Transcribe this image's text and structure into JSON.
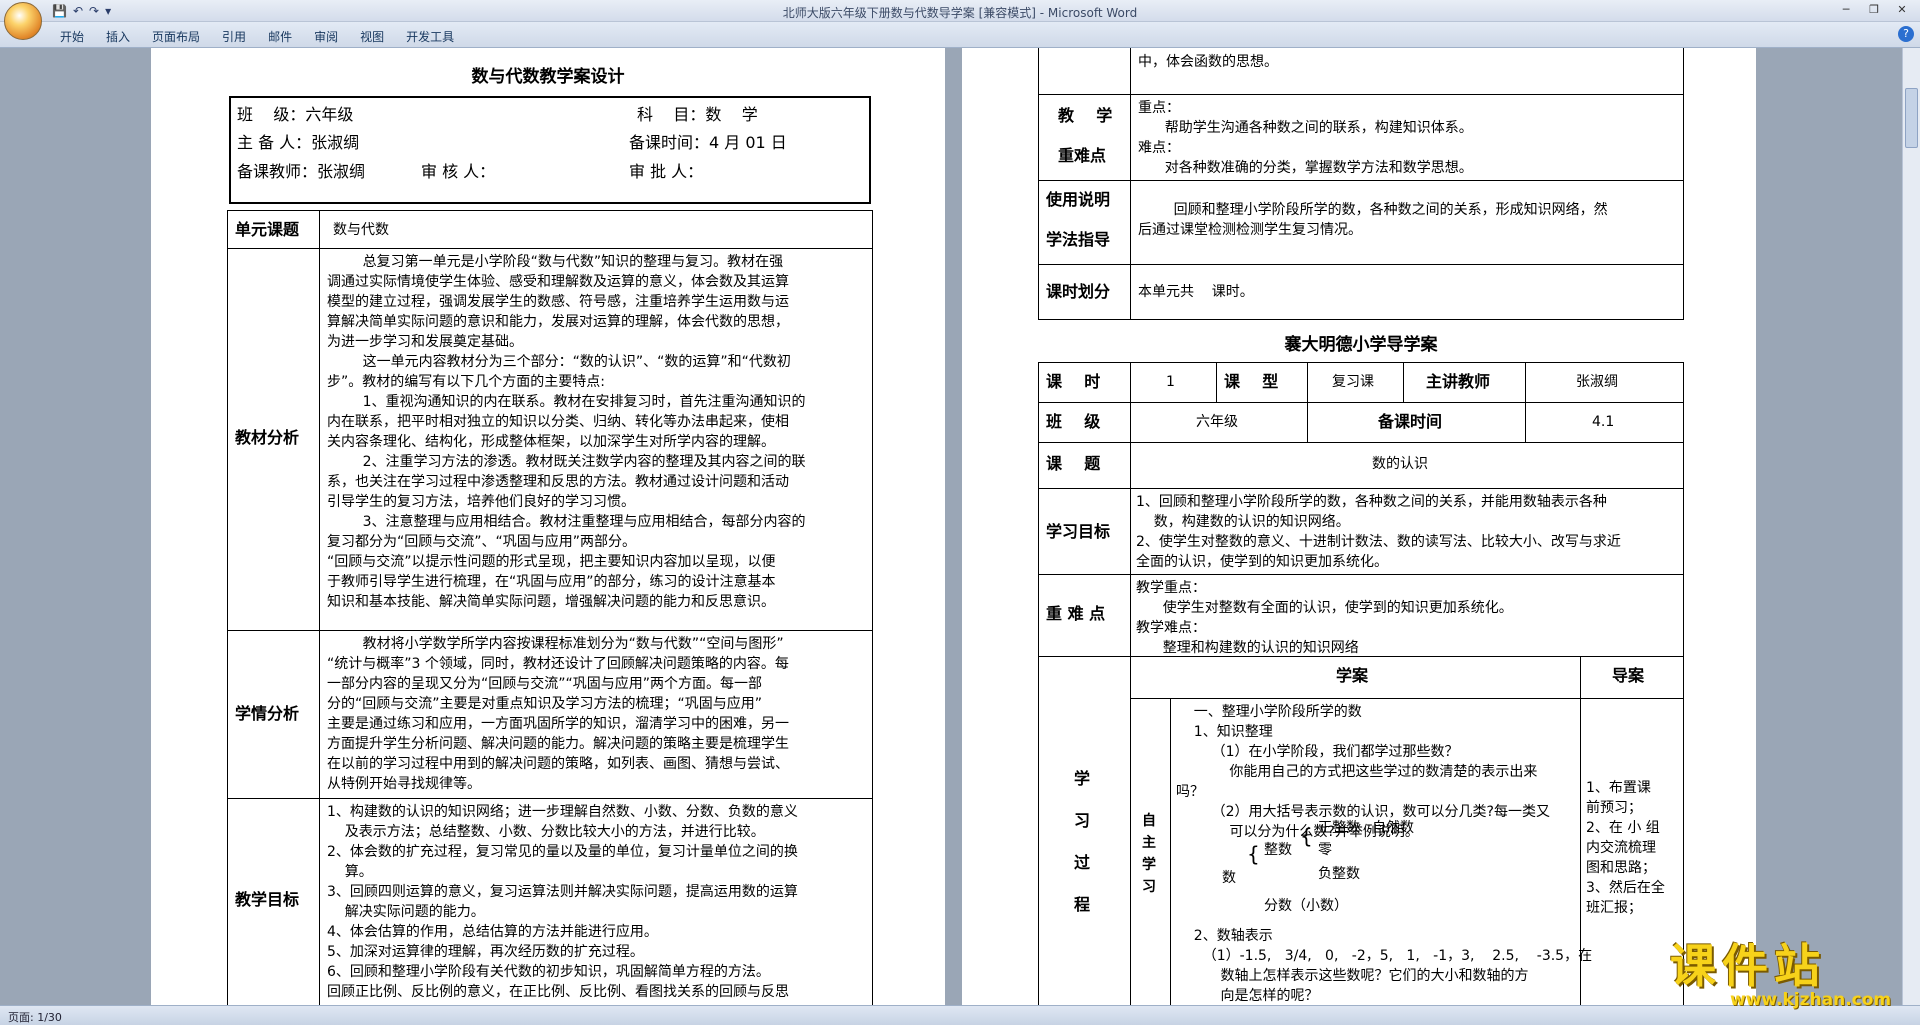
{
  "window": {
    "title": "北师大版六年级下册数与代数导学案 [兼容模式] - Microsoft Word"
  },
  "ribbon": {
    "tabs": [
      "开始",
      "插入",
      "页面布局",
      "引用",
      "邮件",
      "审阅",
      "视图",
      "开发工具"
    ]
  },
  "status": {
    "page": "页面: 1/30"
  },
  "watermark": {
    "text": "课件站",
    "url": "www.kjzhan.com"
  },
  "page1": {
    "title": "数与代数教学案设计",
    "hdr": {
      "r1a": "班    级：六年级",
      "r1b": "科    目：数    学",
      "r2a": "主 备 人：张淑绸",
      "r2b": "备课时间：4 月 01 日",
      "r3a": "备课教师：张淑绸",
      "r3b": "审 核 人：",
      "r3c": "审 批 人："
    },
    "unit_label": "单元课题",
    "unit_value": "数与代数",
    "jcfx_label": "教材分析",
    "jcfx_lines": [
      "        总复习第一单元是小学阶段“数与代数”知识的整理与复习。教材在强",
      "调通过实际情境使学生体验、感受和理解数及运算的意义，体会数及其运算",
      "模型的建立过程，强调发展学生的数感、符号感，注重培养学生运用数与运",
      "算解决简单实际问题的意识和能力，发展对运算的理解，体会代数的思想，",
      "为进一步学习和发展奠定基础。",
      "        这一单元内容教材分为三个部分：“数的认识”、“数的运算”和“代数初",
      "步”。教材的编写有以下几个方面的主要特点:",
      "        1、重视沟通知识的内在联系。教材在安排复习时，首先注重沟通知识的",
      "内在联系，把平时相对独立的知识以分类、归纳、转化等办法串起来，使相",
      "关内容条理化、结构化，形成整体框架，以加深学生对所学内容的理解。",
      "        2、注重学习方法的渗透。教材既关注数学内容的整理及其内容之间的联",
      "系，也关注在学习过程中渗透整理和反思的方法。教材通过设计问题和活动",
      "引导学生的复习方法，培养他们良好的学习习惯。",
      "        3、注意整理与应用相结合。教材注重整理与应用相结合，每部分内容的",
      "复习都分为“回顾与交流”、“巩固与应用”两部分。",
      "“回顾与交流”以提示性问题的形式呈现，把主要知识内容加以呈现，以便",
      "于教师引导学生进行梳理，在“巩固与应用”的部分，练习的设计注意基本",
      "知识和基本技能、解决简单实际问题，增强解决问题的能力和反思意识。"
    ],
    "xqfx_label": "学情分析",
    "xqfx_lines": [
      "        教材将小学数学所学内容按课程标准划分为“数与代数”“空间与图形”",
      "“统计与概率”3 个领域，同时，教材还设计了回顾解决问题策略的内容。每",
      "一部分内容的呈现又分为“回顾与交流”“巩固与应用”两个方面。每一部",
      "分的“回顾与交流”主要是对重点知识及学习方法的梳理；“巩固与应用”",
      "主要是通过练习和应用，一方面巩固所学的知识，溜清学习中的困难，另一",
      "方面提升学生分析问题、解决问题的能力。解决问题的策略主要是梳理学生",
      "在以前的学习过程中用到的解决问题的策略，如列表、画图、猜想与尝试、",
      "从特例开始寻找规律等。"
    ],
    "jxmb_label": "教学目标",
    "jxmb_lines": [
      "1、构建数的认识的知识网络；进一步理解自然数、小数、分数、负数的意义",
      "    及表示方法；总结整数、小数、分数比较大小的方法，并进行比较。",
      "2、体会数的扩充过程，复习常见的量以及量的单位，复习计量单位之间的换",
      "    算。",
      "3、回顾四则运算的意义，复习运算法则并解决实际问题，提高运用数的运算",
      "    解决实际问题的能力。",
      "4、体会估算的作用，总结估算的方法并能进行应用。",
      "5、加深对运算律的理解，再次经历数的扩充过程。",
      "6、回顾和整理小学阶段有关代数的初步知识，巩固解简单方程的方法。",
      "回顾正比例、反比例的意义，在正比例、反比例、看图找关系的回顾与反思"
    ]
  },
  "page2": {
    "top_line": "中，体会函数的思想。",
    "zd_label1": "教    学",
    "zd_label2": "重难点",
    "zd_lines": [
      "重点：",
      "      帮助学生沟通各种数之间的联系，构建知识体系。",
      "难点：",
      "      对各种数准确的分类，掌握数学方法和数学思想。"
    ],
    "sm_label1": "使用说明",
    "sm_label2": "学法指导",
    "sm_lines": [
      "        回顾和整理小学阶段所学的数，各种数之间的关系，形成知识网络，然",
      "后通过课堂检测检测学生复习情况。"
    ],
    "ks_label": "课时划分",
    "ks_value": "本单元共    课时。",
    "title2": "褰大明德小学导学案",
    "g": {
      "kslabel": "课    时",
      "ks": "1",
      "kxlabel": "课    型",
      "kx": "复习课",
      "zjlabel": "主讲教师",
      "zj": "张淑绸",
      "bjlabel": "班    级",
      "bj": "六年级",
      "bklabel": "备课时间",
      "bk": "4.1",
      "ktlabel": "课    题",
      "kt": "数的认识"
    },
    "xxmb_label": "学习目标",
    "xxmb_lines": [
      "1、回顾和整理小学阶段所学的数，各种数之间的关系，并能用数轴表示各种",
      "    数，构建数的认识的知识网络。",
      "2、使学生对整数的意义、十进制计数法、数的读写法、比较大小、改写与求近",
      "全面的认识，使学到的知识更加系统化。"
    ],
    "znd_label": "重 难 点",
    "znd_lines": [
      "教学重点：",
      "      使学生对整数有全面的认识，使学到的知识更加系统化。",
      "教学难点：",
      "      整理和构建数的认识的知识网络"
    ],
    "xa_head": "学案",
    "da_head": "导案",
    "xxgc_label": [
      "学",
      "习",
      "过",
      "程"
    ],
    "zzxx_label": [
      "自",
      "主",
      "学",
      "习"
    ],
    "xa_lines": [
      "    一、整理小学阶段所学的数",
      "    1、知识整理",
      "        （1）在小学阶段，我们都学过那些数？",
      "            你能用自己的方式把这些学过的数清楚的表示出来",
      "吗？",
      "        （2）用大括号表示数的认识，数可以分几类?每一类又",
      "            可以分为什么数?并举例说明。"
    ],
    "tree": {
      "root": "数",
      "zhengshu": "整数",
      "zhengzhengshu": "正整数",
      "ziranshu": "自然数",
      "ling": "零",
      "fuzhengshu": "负整数",
      "fenshu": "分数（小数）"
    },
    "xa_lines2": [
      "    2、数轴表示",
      "      （1）-1.5,   3/4,   0,   -2，5,   1,   -1，3,    2.5,    -3.5，在",
      "          数轴上怎样表示这些数呢？它们的大小和数轴的方",
      "          向是怎样的呢？"
    ],
    "da_lines": [
      "1、布置课",
      "前预习；",
      "2、在 小 组",
      "内交流梳理",
      "图和思路；",
      "3、然后在全",
      "班汇报；"
    ]
  }
}
